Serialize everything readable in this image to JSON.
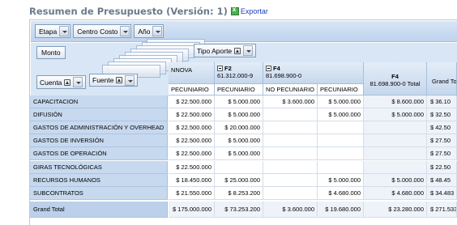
{
  "header": {
    "title": "Resumen de Presupuesto (Versión: 1)",
    "export_label": "Exportar"
  },
  "filters": [
    {
      "label": "Etapa"
    },
    {
      "label": "Centro Costo"
    },
    {
      "label": "Año"
    }
  ],
  "data_field": "Monto",
  "row_fields": {
    "cuenta": "Cuenta",
    "fuente": "Fuente"
  },
  "column_field": "Tipo Aporte",
  "columns": {
    "innova": {
      "partial": "NNOVA",
      "sub": "PECUNIARIO"
    },
    "f2": {
      "name": "F2",
      "code": "61.312.000-9",
      "sub": "PECUNIARIO"
    },
    "f4": {
      "name": "F4",
      "code": "81.698.900-0",
      "sub1": "NO PECUNIARIO",
      "sub2": "PECUNIARIO"
    },
    "f4_total": {
      "name": "F4",
      "label": "81.698.900-0 Total"
    },
    "grand_total": "Grand To"
  },
  "rows": [
    {
      "label": "CAPACITACION",
      "values": [
        "$ 22.500.000",
        "$ 5.000.000",
        "$ 3.600.000",
        "$ 5.000.000",
        "$ 8.600.000",
        "$ 36.10"
      ]
    },
    {
      "label": "DIFUSIÓN",
      "values": [
        "$ 22.500.000",
        "$ 5.000.000",
        "",
        "$ 5.000.000",
        "$ 5.000.000",
        "$ 32.50"
      ]
    },
    {
      "label": "GASTOS DE ADMINISTRACIÓN Y OVERHEAD",
      "values": [
        "$ 22.500.000",
        "$ 20.000.000",
        "",
        "",
        "",
        "$ 42.50"
      ]
    },
    {
      "label": "GASTOS DE INVERSIÓN",
      "values": [
        "$ 22.500.000",
        "$ 5.000.000",
        "",
        "",
        "",
        "$ 27.50"
      ]
    },
    {
      "label": "GASTOS DE OPERACIÓN",
      "values": [
        "$ 22.500.000",
        "$ 5.000.000",
        "",
        "",
        "",
        "$ 27.50"
      ]
    },
    {
      "label": "GIRAS TECNOLÓGICAS",
      "values": [
        "$ 22.500.000",
        "",
        "",
        "",
        "",
        "$ 22.50"
      ]
    },
    {
      "label": "RECURSOS HUMANOS",
      "values": [
        "$ 18.450.000",
        "$ 25.000.000",
        "",
        "$ 5.000.000",
        "$ 5.000.000",
        "$ 48.45"
      ]
    },
    {
      "label": "SUBCONTRATOS",
      "values": [
        "$ 21.550.000",
        "$ 8.253.200",
        "",
        "$ 4.680.000",
        "$ 4.680.000",
        "$ 34.483"
      ]
    }
  ],
  "grand_total": {
    "label": "Grand Total",
    "values": [
      "$ 175.000.000",
      "$ 73.253.200",
      "$ 3.600.000",
      "$ 19.680.000",
      "$ 23.280.000",
      "$ 271.533"
    ]
  },
  "colors": {
    "header_blue": "#c6d7ec",
    "row_label_blue": "#c7d9ef",
    "title_gray": "#6b7b8c",
    "link_blue": "#1d3fb5"
  }
}
